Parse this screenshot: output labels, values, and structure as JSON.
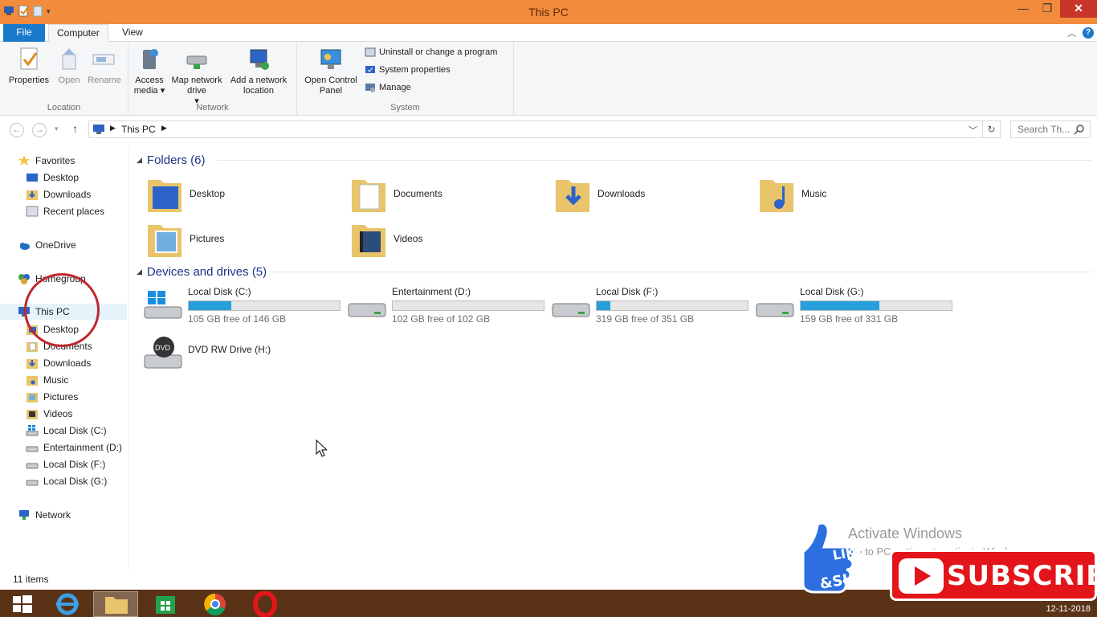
{
  "window": {
    "title": "This PC"
  },
  "ribbon": {
    "tabs": [
      "File",
      "Computer",
      "View"
    ],
    "groups": {
      "location": {
        "label": "Location",
        "buttons": [
          "Properties",
          "Open",
          "Rename"
        ]
      },
      "network": {
        "label": "Network",
        "buttons": [
          "Access media",
          "Map network drive",
          "Add a network location"
        ]
      },
      "system": {
        "label": "System",
        "big_button": "Open Control Panel",
        "small_buttons": [
          "Uninstall or change a program",
          "System properties",
          "Manage"
        ]
      }
    }
  },
  "address": {
    "crumb": "This PC",
    "search_placeholder": "Search Th..."
  },
  "nav": {
    "favorites": {
      "label": "Favorites",
      "items": [
        "Desktop",
        "Downloads",
        "Recent places"
      ]
    },
    "onedrive": "OneDrive",
    "homegroup": "Homegroup",
    "thispc": {
      "label": "This PC",
      "items": [
        "Desktop",
        "Documents",
        "Downloads",
        "Music",
        "Pictures",
        "Videos",
        "Local Disk (C:)",
        "Entertainment (D:)",
        "Local Disk (F:)",
        "Local Disk (G:)"
      ]
    },
    "network": "Network"
  },
  "content": {
    "folders_header": "Folders (6)",
    "folders": [
      "Desktop",
      "Documents",
      "Downloads",
      "Music",
      "Pictures",
      "Videos"
    ],
    "drives_header": "Devices and drives (5)",
    "drives": [
      {
        "name": "Local Disk (C:)",
        "free": "105 GB free of 146 GB",
        "used_fraction": 0.28
      },
      {
        "name": "Entertainment (D:)",
        "free": "102 GB free of 102 GB",
        "used_fraction": 0.0
      },
      {
        "name": "Local Disk (F:)",
        "free": "319 GB free of 351 GB",
        "used_fraction": 0.09
      },
      {
        "name": "Local Disk (G:)",
        "free": "159 GB free of 331 GB",
        "used_fraction": 0.52
      }
    ],
    "dvd": {
      "name": "DVD RW Drive (H:)"
    }
  },
  "status": {
    "items": "11 items"
  },
  "watermark": {
    "line1": "Activate Windows",
    "line2": "Go to PC settings to activate Windows."
  },
  "overlay": {
    "subscribe": "SUBSCRIBE",
    "like": "LIKE & SHARE"
  },
  "taskbar": {
    "date": "12-11-2018"
  },
  "colors": {
    "titlebar": "#f28b3c",
    "accent": "#1979ca",
    "taskbar": "#5a3216",
    "bar_fill": "#26a0da"
  }
}
